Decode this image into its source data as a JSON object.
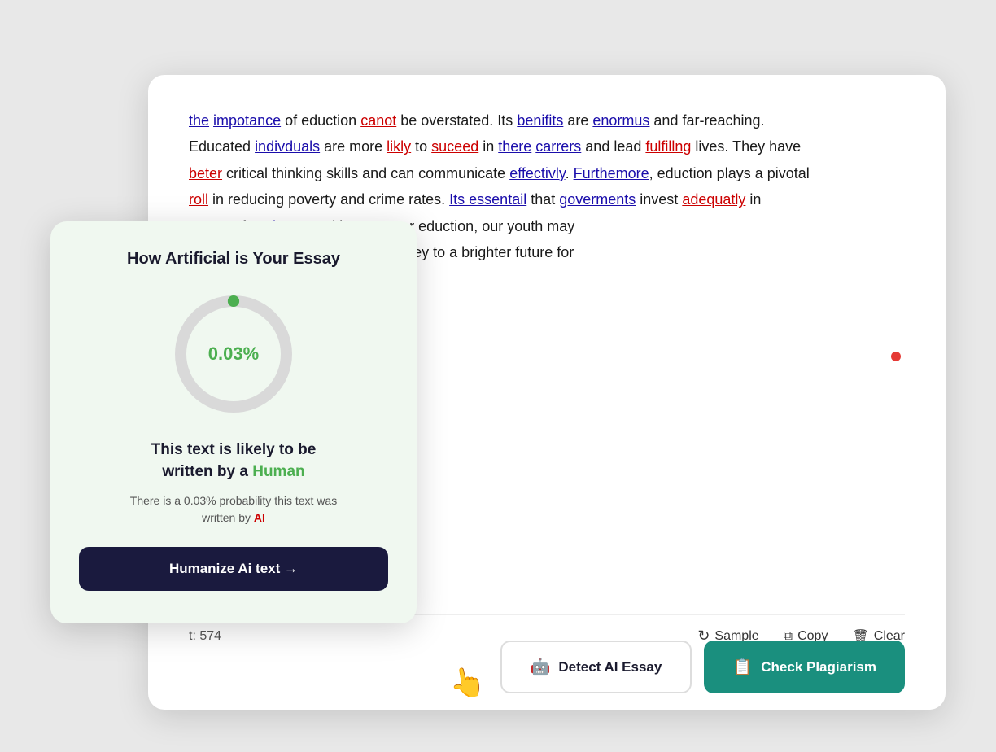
{
  "essay": {
    "text_lines": [
      "the impotance of eduction canot be overstated. Its benifits are enormus and far-reaching.",
      "Educated indivduals are more likly to suceed in there carrers and lead fulfillng lives. They have",
      "beter critical thinking skills and can communicate effectivly. Furthemore, eduction plays a",
      "pivotal roll in reducing poverty and crime rates. Its essentail that goverments invest adequatly in",
      "perety of societyys. Without proper eduction, our youth may",
      "market. In conclution, eduction is key to a brighter future for"
    ]
  },
  "bottom_bar": {
    "word_count_label": "t: 574",
    "sample_label": "Sample",
    "copy_label": "Copy",
    "clear_label": "Clear"
  },
  "buttons": {
    "detect_label": "Detect AI Essay",
    "plagiarism_label": "Check Plagiarism"
  },
  "ai_card": {
    "title": "How Artificial is Your Essay",
    "percentage": "0.03%",
    "result_line1": "This text is likely to be",
    "result_line2": "written by a",
    "human_word": "Human",
    "prob_text1": "There is a 0.03% probability this text was",
    "prob_text2": "written by",
    "ai_word": "AI",
    "humanize_label": "Humanize Ai text →"
  }
}
